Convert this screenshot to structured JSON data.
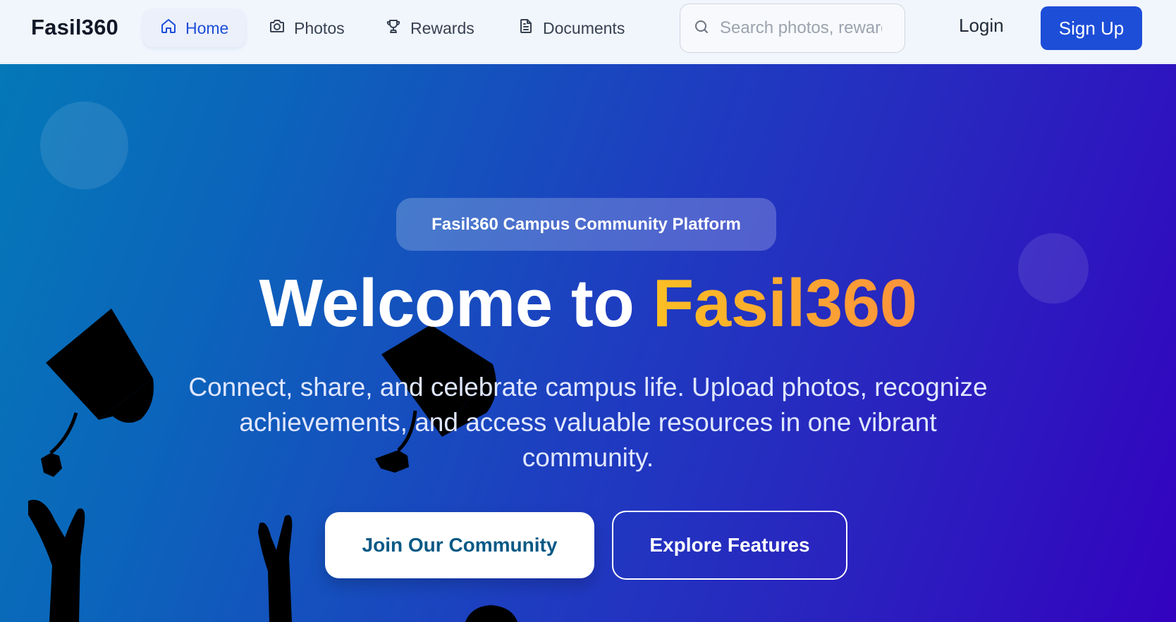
{
  "nav": {
    "brand": "Fasil360",
    "items": [
      {
        "label": "Home",
        "icon": "home-icon",
        "active": true
      },
      {
        "label": "Photos",
        "icon": "camera-icon",
        "active": false
      },
      {
        "label": "Rewards",
        "icon": "trophy-icon",
        "active": false
      },
      {
        "label": "Documents",
        "icon": "document-icon",
        "active": false
      }
    ],
    "search": {
      "placeholder": "Search photos, rewards...",
      "value": ""
    },
    "login_label": "Login",
    "signup_label": "Sign Up"
  },
  "hero": {
    "badge": "Fasil360 Campus Community Platform",
    "headline_prefix": "Welcome to ",
    "headline_accent": "Fasil360",
    "subtext": "Connect, share, and celebrate campus life. Upload photos, recognize achievements, and access valuable resources in one vibrant community.",
    "primary_cta": "Join Our Community",
    "secondary_cta": "Explore Features"
  },
  "colors": {
    "brand_blue": "#1d4ed8",
    "hero_gradient_start": "#0478b8",
    "hero_gradient_end": "#3302bf",
    "accent_gradient_start": "#fbbf24",
    "accent_gradient_end": "#fb923c",
    "cta_text": "#075985"
  }
}
